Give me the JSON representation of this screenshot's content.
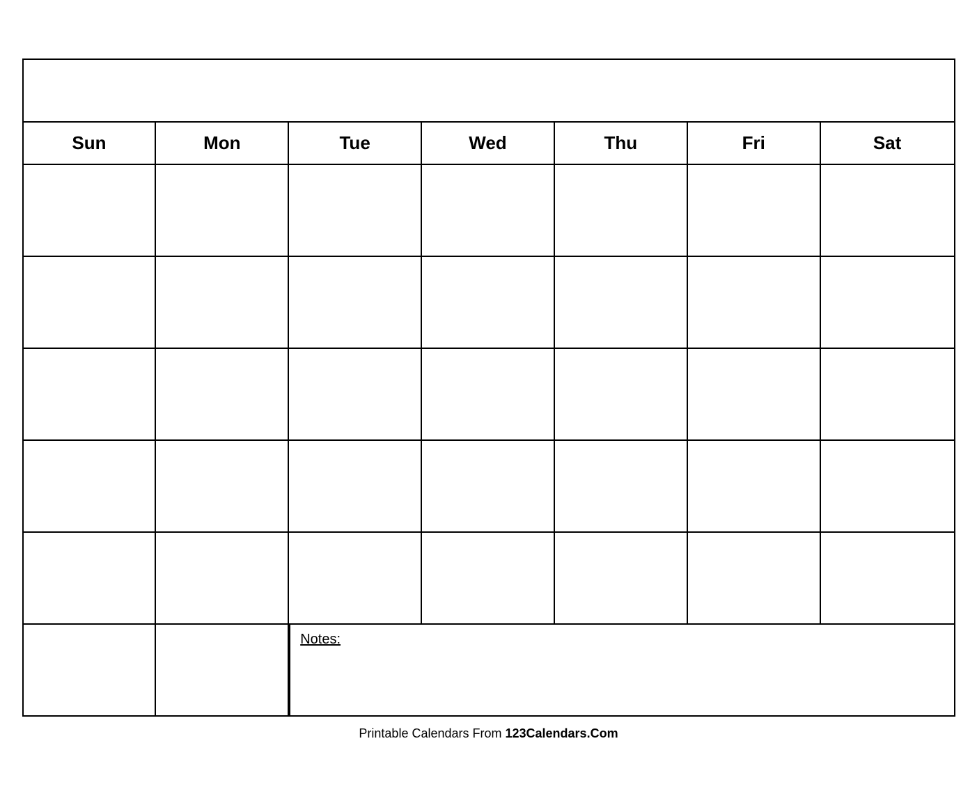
{
  "calendar": {
    "title": "",
    "days": [
      "Sun",
      "Mon",
      "Tue",
      "Wed",
      "Thu",
      "Fri",
      "Sat"
    ],
    "rows": 5,
    "notes_label": "Notes:",
    "footer_normal": "Printable Calendars From ",
    "footer_bold": "123Calendars.Com"
  }
}
